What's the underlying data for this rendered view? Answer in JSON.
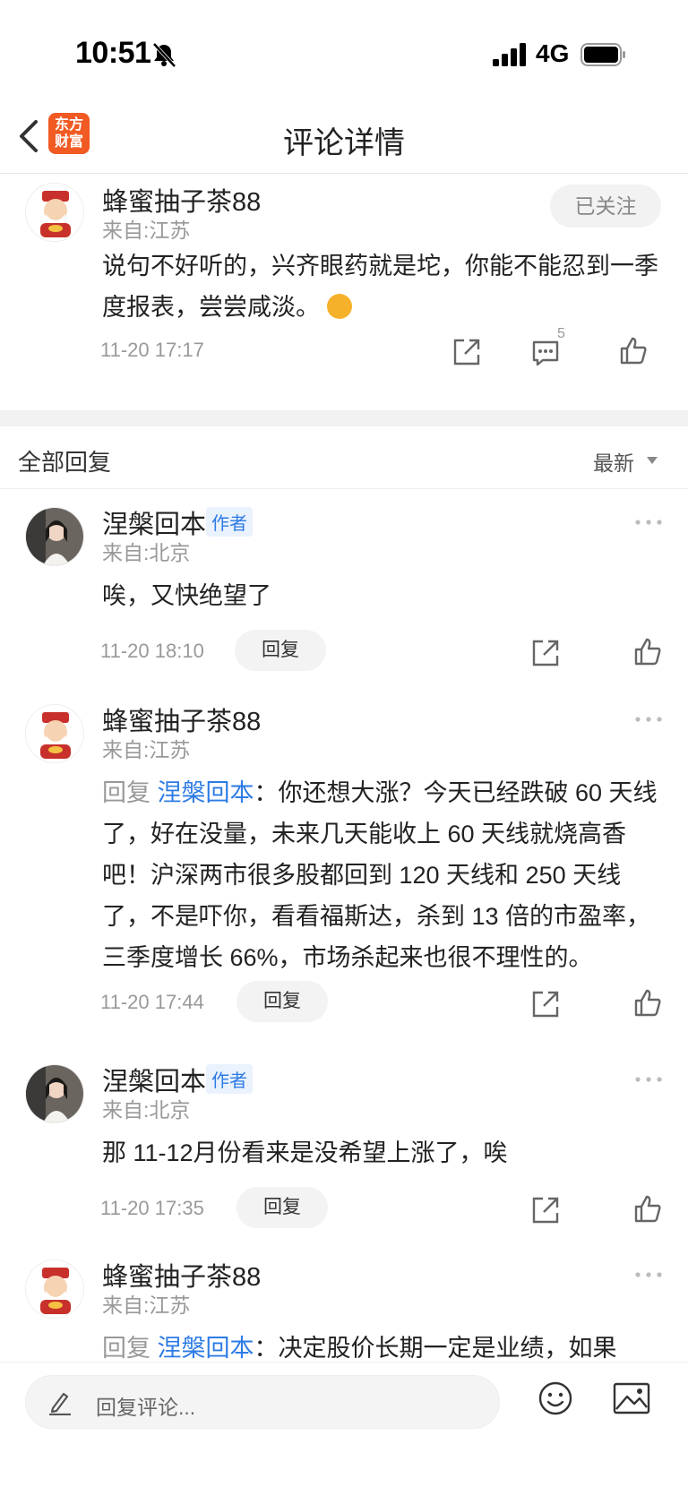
{
  "status_bar": {
    "time": "10:51",
    "network": "4G"
  },
  "nav": {
    "title": "评论详情",
    "logo_text_line1": "东方",
    "logo_text_line2": "财富"
  },
  "main_comment": {
    "user": "蜂蜜抽子茶88",
    "location": "来自:江苏",
    "follow_label": "已关注",
    "text": "说句不好听的，兴齐眼药就是坨，你能不能忍到一季度报表，尝尝咸淡。",
    "time": "11-20 17:17",
    "comment_count": "5"
  },
  "replies_header": {
    "title": "全部回复",
    "sort": "最新"
  },
  "replies": [
    {
      "user": "涅槃回本",
      "tag": "作者",
      "location": "来自:北京",
      "prefix": "",
      "target": "",
      "text": "唉，又快绝望了",
      "time": "11-20 18:10",
      "reply_label": "回复"
    },
    {
      "user": "蜂蜜抽子茶88",
      "tag": "",
      "location": "来自:江苏",
      "prefix": "回复",
      "target": "涅槃回本",
      "text": "：你还想大涨？今天已经跌破 60 天线了，好在没量，未来几天能收上 60 天线就烧高香吧！沪深两市很多股都回到 120 天线和 250 天线了，不是吓你，看看福斯达，杀到 13 倍的市盈率，三季度增长 66%，市场杀起来也很不理性的。",
      "time": "11-20 17:44",
      "reply_label": "回复"
    },
    {
      "user": "涅槃回本",
      "tag": "作者",
      "location": "来自:北京",
      "prefix": "",
      "target": "",
      "text": "那 11-12月份看来是没希望上涨了，唉",
      "time": "11-20 17:35",
      "reply_label": "回复"
    },
    {
      "user": "蜂蜜抽子茶88",
      "tag": "",
      "location": "来自:江苏",
      "prefix": "回复",
      "target": "涅槃回本",
      "text": "：决定股价长期一定是业绩，如果",
      "time": "",
      "reply_label": ""
    }
  ],
  "bottom_bar": {
    "placeholder": "回复评论..."
  },
  "colors": {
    "accent": "#2d7be5",
    "brand": "#f15a22"
  }
}
